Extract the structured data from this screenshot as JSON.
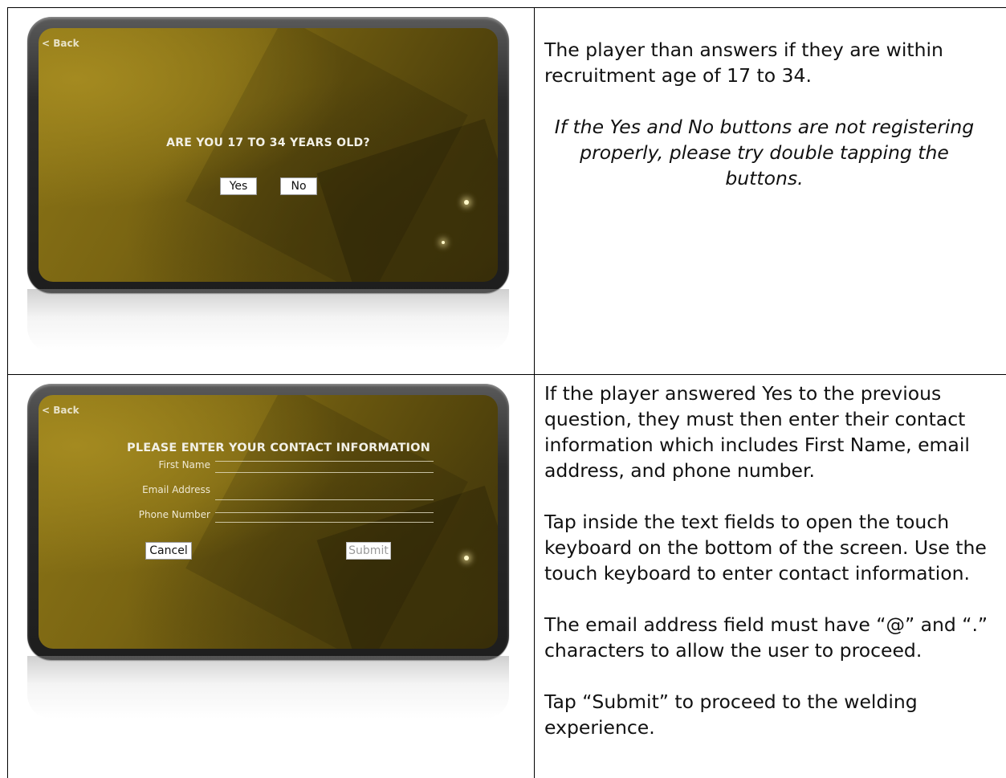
{
  "row1": {
    "screen": {
      "back_label": "< Back",
      "question": "ARE YOU 17 TO 34 YEARS OLD?",
      "yes_label": "Yes",
      "no_label": "No"
    },
    "text": {
      "p1": "The player than answers if they are within recruitment age of 17 to 34.",
      "p2": "If the Yes and No buttons are not registering properly, please try double tapping the buttons."
    }
  },
  "row2": {
    "screen": {
      "back_label": "< Back",
      "title": "PLEASE ENTER YOUR CONTACT INFORMATION",
      "fields": [
        "First Name",
        "Email Address",
        "Phone Number"
      ],
      "cancel_label": "Cancel",
      "submit_label": "Submit"
    },
    "text": {
      "p1": "If the player answered Yes to the previous question, they must then enter their contact information which includes First Name, email address, and phone number.",
      "p2": "Tap inside the text fields to open the touch keyboard on the bottom of the screen. Use the touch keyboard to enter contact information.",
      "p3": "The email address field must have “@” and “.” characters to allow the user to proceed.",
      "p4": "Tap “Submit” to proceed to the welding experience."
    }
  }
}
